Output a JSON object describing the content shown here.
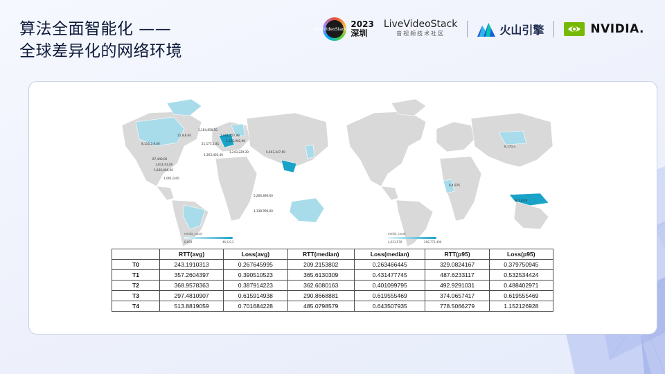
{
  "slide": {
    "title_line1": "算法全面智能化 ——",
    "title_line2": "全球差异化的网络环境"
  },
  "logos": {
    "conf_badge": "LiveVideoStackCon",
    "conf_year": "2023",
    "conf_city": "深圳",
    "lvs_name": "LiveVideoStack",
    "lvs_tagline": "音视频技术社区",
    "volcano": "火山引擎",
    "nvidia": "NVIDIA."
  },
  "maps": {
    "left": {
      "labels": [
        "8,116,2,8.00",
        "15,9,8.60",
        "1,184,850.50",
        "21,175,1,81",
        "1,001,257,98",
        "1,313,902,98",
        "1,263,403,40",
        "1,243,229,30",
        "5,403,347,60",
        "87,440,00",
        "1,831,63,00",
        "1,836,000,00",
        "1,001,0,00",
        "5,266,896,60",
        "1,138,990,00"
      ],
      "scale_label": "media_count",
      "scale_min": "8,893",
      "scale_max": "46,6,0,2"
    },
    "right": {
      "labels": [
        "8,170,a",
        "8,4,976",
        "8,1,8,40"
      ],
      "scale_label": "media_count",
      "scale_min": "4,623,578",
      "scale_max": "268,771,496"
    }
  },
  "table": {
    "headers": [
      "",
      "RTT(avg)",
      "Loss(avg)",
      "RTT(median)",
      "Loss(median)",
      "RTT(p95)",
      "Loss(p95)"
    ],
    "rows": [
      [
        "T0",
        "243.1910313",
        "0.267645995",
        "209.2153802",
        "0.263466445",
        "329.0824167",
        "0.379750945"
      ],
      [
        "T1",
        "357.2604397",
        "0.390510523",
        "365.6130309",
        "0.431477745",
        "487.6233117",
        "0.532534424"
      ],
      [
        "T2",
        "368.9578363",
        "0.387914223",
        "362.6080163",
        "0.401099795",
        "492.9291031",
        "0.488402971"
      ],
      [
        "T3",
        "297.4810907",
        "0.615914938",
        "290.8668881",
        "0.619555469",
        "374.0657417",
        "0.619555469"
      ],
      [
        "T4",
        "513.8819059",
        "0.701684228",
        "485.0798579",
        "0.643507935",
        "778.5066279",
        "1.152126928"
      ]
    ]
  },
  "colors": {
    "accent_blue": "#1aa3c8",
    "light_blue": "#a9dcea",
    "land_gray": "#d9d9d9",
    "card_border": "#c5d0ea"
  }
}
